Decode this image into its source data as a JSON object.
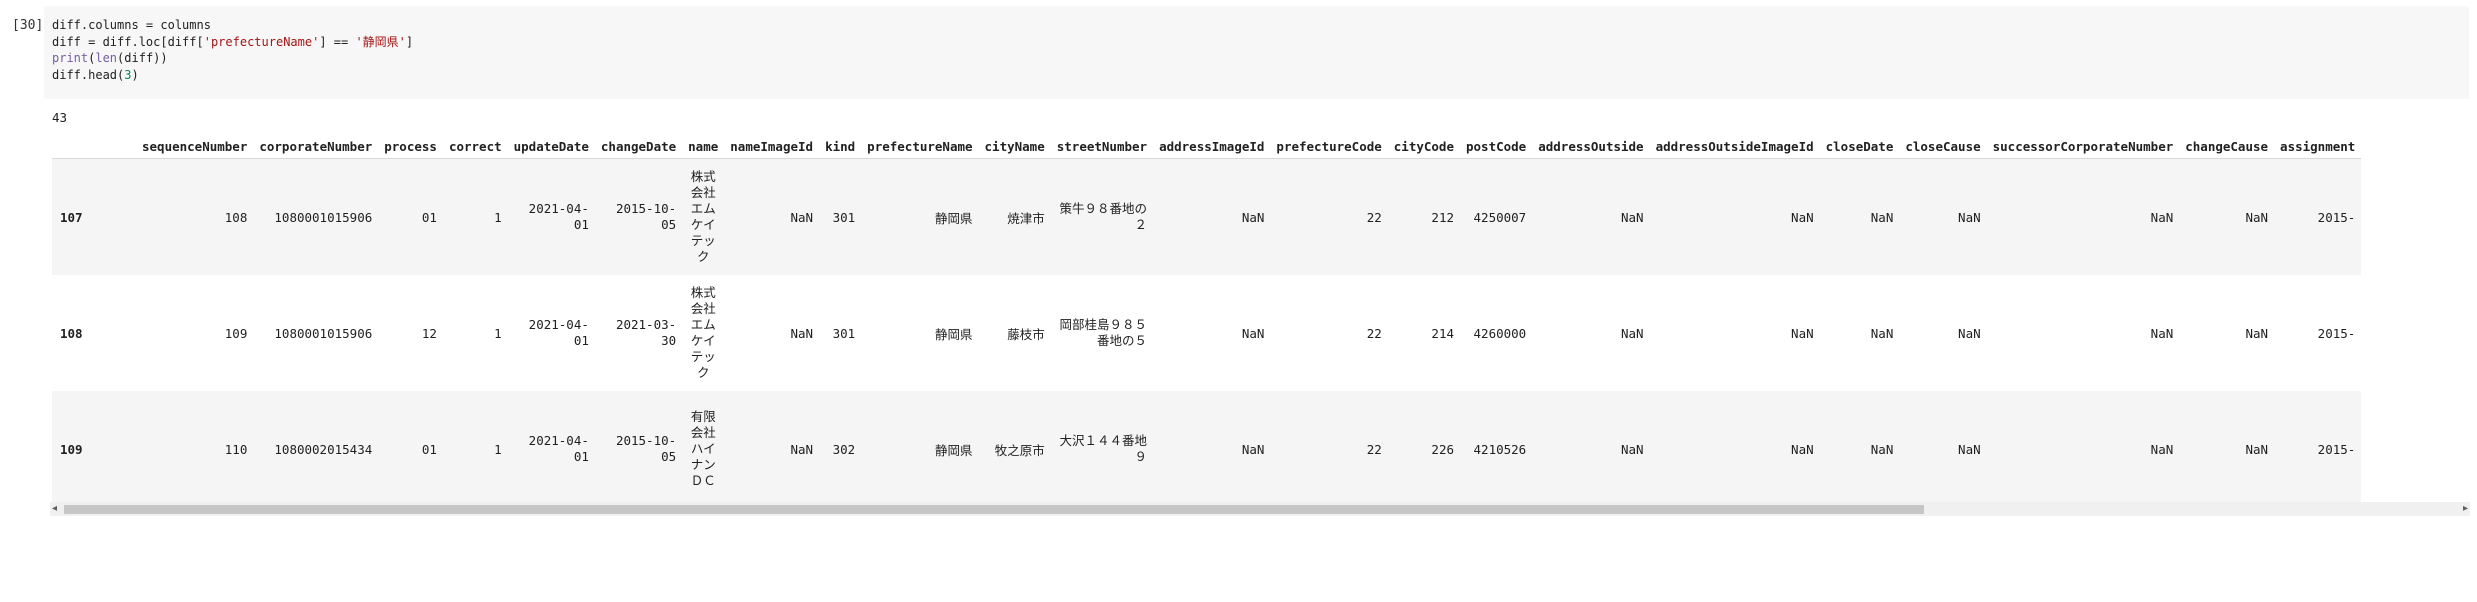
{
  "cell": {
    "exec_label": "[30]",
    "code_lines": [
      "diff.columns = columns",
      "diff = diff.loc[diff['prefectureName'] == '静岡県']",
      "print(len(diff))",
      "diff.head(3)"
    ]
  },
  "output": {
    "printed": "43",
    "table": {
      "columns": [
        "sequenceNumber",
        "corporateNumber",
        "process",
        "correct",
        "updateDate",
        "changeDate",
        "name",
        "nameImageId",
        "kind",
        "prefectureName",
        "cityName",
        "streetNumber",
        "addressImageId",
        "prefectureCode",
        "cityCode",
        "postCode",
        "addressOutside",
        "addressOutsideImageId",
        "closeDate",
        "closeCause",
        "successorCorporateNumber",
        "changeCause",
        "assignment"
      ],
      "rows": [
        {
          "index": "107",
          "cells": [
            "108",
            "1080001015906",
            "01",
            "1",
            "2021-04-01",
            "2015-10-05",
            "株式会社エムケイテック",
            "NaN",
            "301",
            "静岡県",
            "焼津市",
            "策牛９８番地の２",
            "NaN",
            "22",
            "212",
            "4250007",
            "NaN",
            "NaN",
            "NaN",
            "NaN",
            "NaN",
            "NaN",
            "2015-"
          ]
        },
        {
          "index": "108",
          "cells": [
            "109",
            "1080001015906",
            "12",
            "1",
            "2021-04-01",
            "2021-03-30",
            "株式会社エムケイテック",
            "NaN",
            "301",
            "静岡県",
            "藤枝市",
            "岡部桂島９８５番地の５",
            "NaN",
            "22",
            "214",
            "4260000",
            "NaN",
            "NaN",
            "NaN",
            "NaN",
            "NaN",
            "NaN",
            "2015-"
          ]
        },
        {
          "index": "109",
          "cells": [
            "110",
            "1080002015434",
            "01",
            "1",
            "2021-04-01",
            "2015-10-05",
            "有限会社ハイナンＤＣ",
            "NaN",
            "302",
            "静岡県",
            "牧之原市",
            "大沢１４４番地９",
            "NaN",
            "22",
            "226",
            "4210526",
            "NaN",
            "NaN",
            "NaN",
            "NaN",
            "NaN",
            "NaN",
            "2015-"
          ]
        }
      ]
    }
  },
  "scrollbar": {
    "left_arrow": "◂",
    "right_arrow": "▸"
  }
}
